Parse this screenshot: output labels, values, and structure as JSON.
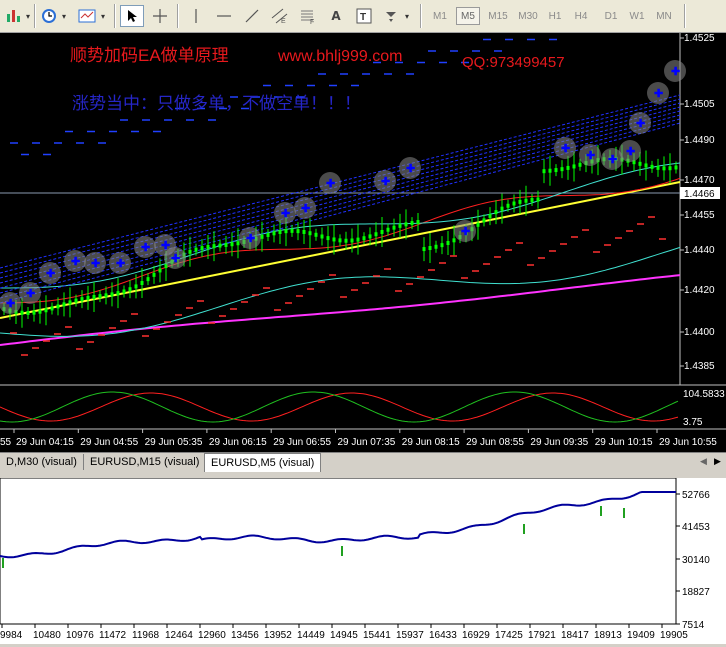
{
  "toolbar": {
    "timeframes": [
      "M1",
      "M5",
      "M15",
      "M30",
      "H1",
      "H4",
      "D1",
      "W1",
      "MN"
    ],
    "active_timeframe": "M5",
    "icons": [
      "chart-bars-icon",
      "dropdown-arrow-icon",
      "clock-icon",
      "dropdown-arrow-icon",
      "template-icon",
      "dropdown-arrow-icon",
      "cursor-icon",
      "crosshair-icon",
      "vertical-line-icon",
      "horizontal-line-icon",
      "trendline-icon",
      "equidistant-channel-icon",
      "fibonacci-icon",
      "text-A-icon",
      "text-label-icon",
      "arrows-icon",
      "dropdown-arrow-icon"
    ],
    "text_tool_label": "A"
  },
  "main_chart": {
    "overlay_text_1": "顺势加码EA做单原理",
    "overlay_url": "www.bhlj999.com",
    "overlay_qq": "QQ:973499457",
    "overlay_text_2": "涨势当中：只做多单，不做空单！！！",
    "price_labels": [
      "1.4525",
      "1.4505",
      "1.4490",
      "1.4470",
      "1.4455",
      "1.4440",
      "1.4420",
      "1.4400",
      "1.4385"
    ],
    "current_price": "1.4466",
    "indicator_labels": [
      "104.5833",
      "3.75"
    ],
    "time_labels": [
      "29 Jun 04:15",
      "29 Jun 04:55",
      "29 Jun 05:35",
      "29 Jun 06:15",
      "29 Jun 06:55",
      "29 Jun 07:35",
      "29 Jun 08:15",
      "29 Jun 08:55",
      "29 Jun 09:35",
      "29 Jun 10:15",
      "29 Jun 10:55"
    ],
    "left_time_fragment": "55",
    "colors": {
      "price_line": "#c0c0c0",
      "ma_yellow": "#ffff33",
      "ma_magenta": "#ff33ff",
      "ma_red": "#ff2020",
      "ma_cyan": "#40e0d0",
      "buy_markers": "#0000ff",
      "candles": "#00ff00"
    }
  },
  "tabs": [
    {
      "label": "D,M30 (visual)"
    },
    {
      "label": "EURUSD,M15 (visual)"
    },
    {
      "label": "EURUSD,M5 (visual)",
      "active": true
    }
  ],
  "equity_chart": {
    "y_labels": [
      "52766",
      "41453",
      "30140",
      "18827",
      "7514"
    ],
    "x_labels": [
      "9984",
      "10480",
      "10976",
      "11472",
      "11968",
      "12464",
      "12960",
      "13456",
      "13952",
      "14449",
      "14945",
      "15441",
      "15937",
      "16433",
      "16929",
      "17425",
      "17921",
      "18417",
      "18913",
      "19409",
      "19905"
    ],
    "line_color": "#00009c"
  }
}
